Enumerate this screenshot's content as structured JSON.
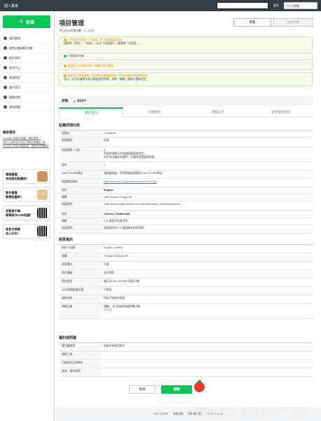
{
  "topbar": {
    "brand": "個人賣家",
    "lang_label": "語言",
    "lang_value": "中文(繁體)"
  },
  "sidebar": {
    "new_label": "新增",
    "items": [
      {
        "label": "項目管理",
        "icon": "list-icon",
        "chev": ""
      },
      {
        "label": "販售金額/匯款金額",
        "icon": "coin-icon",
        "chev": "⌄"
      },
      {
        "label": "統計資訊",
        "icon": "chart-icon",
        "chev": "⌄"
      },
      {
        "label": "訊息中心",
        "icon": "bell-icon",
        "chev": ""
      },
      {
        "label": "帳號設定",
        "icon": "user-icon",
        "chev": ""
      },
      {
        "label": "製作導引",
        "icon": "book-icon",
        "chev": "⌄"
      },
      {
        "label": "服務說明",
        "icon": "doc-icon",
        "chev": ""
      },
      {
        "label": "常見問題",
        "icon": "help-icon",
        "chev": ""
      }
    ],
    "news_title": "最新資訊",
    "news": [
      "LINE個人原創市集顧…開放販售☆",
      "適於九週和製作項目不開放實體除了參",
      "LINE個人原創市集貼圖，重要申請規範的"
    ],
    "promos": [
      {
        "text1": "實際看看",
        "text2": "完成後的貼圖吧！",
        "img": "sticker-preview-icon"
      },
      {
        "text1": "製作看看",
        "text2": "動態貼圖吧！",
        "img": "animated-sticker-icon"
      },
      {
        "text1": "用智慧手機",
        "text2": "簡單製作LINE貼圖！",
        "img": "phone-qr-icon"
      },
      {
        "text1": "將官方帳號",
        "text2": "加入好友！",
        "img": "official-qr-icon"
      }
    ]
  },
  "header": {
    "title": "項目管理",
    "deadline": "今日送出申請次數：0 / 30次",
    "preview": "預覽",
    "submit": "送出申請"
  },
  "alerts": [
    {
      "text": "已完成所需項目「大貼圖」等（詳情請見這裏）",
      "sub": "請點擊「要項」>「貼圖」>在於「貼圖顯示」處選擇「大貼圖」。",
      "type": "warn"
    },
    {
      "text": "內容儲存完畢",
      "type": "ok"
    },
    {
      "text": "貼圖大小未完整反映，請確認是否確認。",
      "type": "warn"
    },
    {
      "text": "確認是否需販售後，本項將在通過審核後3~5天內自動為您變更販售。",
      "sub": "此外，在您未編輯本表自動變更的時間，請按「編輯」鍵後可重新設定。",
      "type": "warn"
    }
  ],
  "status": {
    "label": "狀態",
    "value": "編輯中"
  },
  "tabs": [
    "顯示資訊",
    "貼圖圖片",
    "標籤設定",
    "販售價格資訊"
  ],
  "detail": {
    "section": "貼圖詳細內容",
    "rows": [
      {
        "k": "貼圖ID",
        "v": "17528238"
      },
      {
        "k": "貼圖類型",
        "v": "貼圖"
      },
      {
        "k": "貼圖張數（1組）",
        "v": "8",
        "v2": "貼圖的張數可在貼圖組圖頁面設定。",
        "v3": "未於送出審核申請時，可隨時變更貼圖張數。"
      },
      {
        "k": "版本",
        "v": "1"
      },
      {
        "k": "LINE STORE網址",
        "v": "通過審核後，您將能確認貼圖的LINE STORE網址。"
      },
      {
        "k": "貼圖預告網址",
        "v": "https://line.me/S/shop/sticker/author/1007817",
        "link": true
      },
      {
        "k": "語言",
        "v": "English",
        "bold": true
      },
      {
        "k": "標題",
        "v": "Little Tomato Foody Life"
      },
      {
        "k": "貼圖說明",
        "v": "Little tomato super loves to eat and has many cutest expressions."
      },
      {
        "k": "語言",
        "v": "Chinese (Traditional)",
        "bold": true
      },
      {
        "k": "標題",
        "v": "小小番茄的吃貨日常"
      },
      {
        "k": "貼圖說明",
        "v": "超級愛吃的小小番茄擁有很多表情"
      }
    ]
  },
  "sales": {
    "section": "販售資訊",
    "rows": [
      {
        "k": "創作人名稱",
        "v": "English: LinfaFu"
      },
      {
        "k": "版權",
        "v": "TOMATOMOMSLIFE"
      },
      {
        "k": "適用場所",
        "v": "可愛"
      },
      {
        "k": "角色種類",
        "v": "女性角色"
      },
      {
        "k": "隱私設定",
        "v": "顯示於LINE STORE/貼圖小鋪"
      },
      {
        "k": "LINE貼圖推薦方案",
        "v": "不參加"
      },
      {
        "k": "販售地區",
        "v": "所有可販售的地區"
      },
      {
        "k": "特輯企劃",
        "v": "標題：\"在\"與資訊貼圖特輯活動\"",
        "v2": "不參加"
      }
    ]
  },
  "rights": {
    "section": "權利證明書",
    "rows": [
      {
        "k": "著作權使用",
        "v": "貼圖中有使用照片"
      },
      {
        "k": "檔案上傳",
        "v": ""
      },
      {
        "k": "可確認作品的網址",
        "v": ""
      },
      {
        "k": "其他、補充說明",
        "v": ""
      }
    ]
  },
  "actions": {
    "cancel": "刪除",
    "edit": "編輯"
  },
  "footer": {
    "links": [
      "LINE STORE",
      "服務規範",
      "隱私權政策",
      "© LINE Corpor"
    ]
  },
  "watermark": "Tomato Mom's Life"
}
